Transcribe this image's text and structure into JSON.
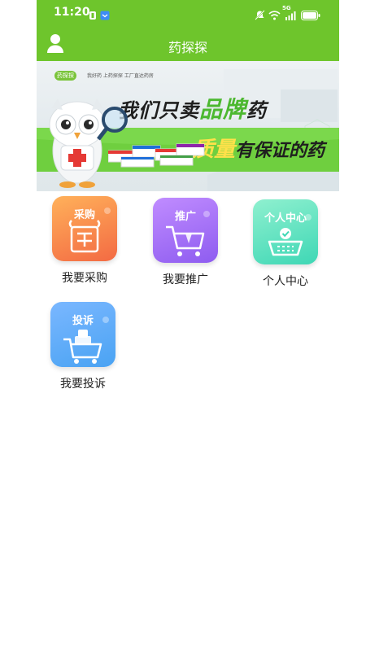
{
  "status_bar": {
    "time": "11:20",
    "network": "5G"
  },
  "header": {
    "title": "药探探"
  },
  "banner": {
    "brand_badge": "药探探",
    "brand_tagline": "我好药 上药探探 工厂直达药房",
    "headline_1": "我们只卖",
    "headline_1_highlight": "品牌",
    "headline_1_tail": "药",
    "headline_2_highlight": "质量",
    "headline_2_tail": "有保证的药"
  },
  "menu": [
    {
      "tag": "采购",
      "label": "我要采购",
      "icon": "purchase-icon"
    },
    {
      "tag": "推广",
      "label": "我要推广",
      "icon": "promotion-cart-icon"
    },
    {
      "tag": "个人中心",
      "label": "个人中心",
      "icon": "basket-check-icon"
    },
    {
      "tag": "投诉",
      "label": "我要投诉",
      "icon": "complaint-cart-icon"
    }
  ],
  "colors": {
    "header_green": "#6ec52c",
    "purchase": "#f36a43",
    "promotion": "#8e5cf0",
    "personal": "#3ed7b5",
    "complaint": "#4aa3f3"
  }
}
